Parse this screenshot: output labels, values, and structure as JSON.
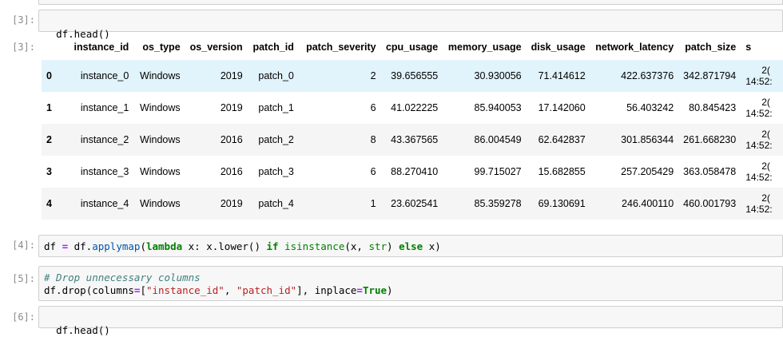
{
  "cells": {
    "c3": {
      "prompt": "[3]:",
      "code": "df.head()",
      "out_prompt": "[3]:"
    },
    "c4": {
      "prompt": "[4]:"
    },
    "c5": {
      "prompt": "[5]:",
      "comment": "# Drop unnecessary columns"
    },
    "c6": {
      "prompt": "[6]:",
      "code": "df.head()"
    }
  },
  "code4": {
    "a": "df ",
    "eq": "=",
    "b": " df.",
    "fn": "applymap",
    "c": "(",
    "lambda": "lambda",
    "d": " x: x.",
    "fn2": "lower",
    "e": "() ",
    "if": "if",
    "f": " ",
    "isinstance": "isinstance",
    "g": "(x, ",
    "str": "str",
    "h": ") ",
    "else": "else",
    "i": " x)"
  },
  "code5": {
    "a": "df.",
    "fn": "drop",
    "b": "(columns",
    "eq": "=",
    "c": "[",
    "s1": "\"instance_id\"",
    "d": ", ",
    "s2": "\"patch_id\"",
    "e": "], inplace",
    "eq2": "=",
    "true": "True",
    "f": ")"
  },
  "table": {
    "columns": [
      "",
      "instance_id",
      "os_type",
      "os_version",
      "patch_id",
      "patch_severity",
      "cpu_usage",
      "memory_usage",
      "disk_usage",
      "network_latency",
      "patch_size",
      "s"
    ],
    "rows": [
      {
        "idx": "0",
        "instance_id": "instance_0",
        "os_type": "Windows",
        "os_version": "2019",
        "patch_id": "patch_0",
        "patch_severity": "2",
        "cpu_usage": "39.656555",
        "memory_usage": "30.930056",
        "disk_usage": "71.414612",
        "network_latency": "422.637376",
        "patch_size": "342.871794",
        "ts_top": "2(",
        "ts_bot": "14:52:"
      },
      {
        "idx": "1",
        "instance_id": "instance_1",
        "os_type": "Windows",
        "os_version": "2019",
        "patch_id": "patch_1",
        "patch_severity": "6",
        "cpu_usage": "41.022225",
        "memory_usage": "85.940053",
        "disk_usage": "17.142060",
        "network_latency": "56.403242",
        "patch_size": "80.845423",
        "ts_top": "2(",
        "ts_bot": "14:52:"
      },
      {
        "idx": "2",
        "instance_id": "instance_2",
        "os_type": "Windows",
        "os_version": "2016",
        "patch_id": "patch_2",
        "patch_severity": "8",
        "cpu_usage": "43.367565",
        "memory_usage": "86.004549",
        "disk_usage": "62.642837",
        "network_latency": "301.856344",
        "patch_size": "261.668230",
        "ts_top": "2(",
        "ts_bot": "14:52:"
      },
      {
        "idx": "3",
        "instance_id": "instance_3",
        "os_type": "Windows",
        "os_version": "2016",
        "patch_id": "patch_3",
        "patch_severity": "6",
        "cpu_usage": "88.270410",
        "memory_usage": "99.715027",
        "disk_usage": "15.682855",
        "network_latency": "257.205429",
        "patch_size": "363.058478",
        "ts_top": "2(",
        "ts_bot": "14:52:"
      },
      {
        "idx": "4",
        "instance_id": "instance_4",
        "os_type": "Windows",
        "os_version": "2019",
        "patch_id": "patch_4",
        "patch_severity": "1",
        "cpu_usage": "23.602541",
        "memory_usage": "85.359278",
        "disk_usage": "69.130691",
        "network_latency": "246.400110",
        "patch_size": "460.001793",
        "ts_top": "2(",
        "ts_bot": "14:52:"
      }
    ]
  },
  "colors": {
    "row_hover": "#e1f3fb",
    "prompt": "#8a8a8a",
    "keyword": "#008000",
    "string": "#ba2121",
    "operator": "#aa22ff",
    "comment": "#408080"
  }
}
